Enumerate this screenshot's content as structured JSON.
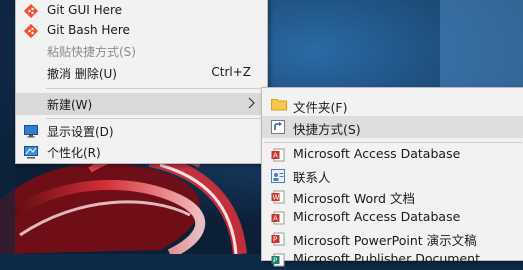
{
  "main_menu": {
    "items": [
      {
        "label": "Git GUI Here",
        "icon": "git-icon"
      },
      {
        "label": "Git Bash Here",
        "icon": "git-icon"
      },
      {
        "label": "粘贴快捷方式(S)",
        "disabled": true
      },
      {
        "label": "撤消 删除(U)",
        "shortcut": "Ctrl+Z"
      },
      {
        "label": "新建(W)",
        "submenu_arrow": "chevron-right-icon"
      },
      {
        "label": "显示设置(D)",
        "icon": "display-icon"
      },
      {
        "label": "个性化(R)",
        "icon": "personalize-icon"
      }
    ]
  },
  "sub_menu": {
    "items": [
      {
        "label": "文件夹(F)",
        "icon": "folder-icon"
      },
      {
        "label": "快捷方式(S)",
        "icon": "shortcut-icon"
      },
      {
        "label": "Microsoft Access Database",
        "icon": "access-icon"
      },
      {
        "label": "联系人",
        "icon": "contact-icon"
      },
      {
        "label": "Microsoft Word 文档",
        "icon": "word-icon"
      },
      {
        "label": "Microsoft Access Database",
        "icon": "access-icon"
      },
      {
        "label": "Microsoft PowerPoint 演示文稿",
        "icon": "powerpoint-icon"
      },
      {
        "label": "Microsoft Publisher Document",
        "icon": "publisher-icon"
      }
    ]
  },
  "colors": {
    "menu_bg": "#f2f2f2",
    "hover_bg": "#d9d9d9",
    "git_orange": "#f05133",
    "folder_yellow": "#f8c74a",
    "office_red": "#c4362c"
  }
}
